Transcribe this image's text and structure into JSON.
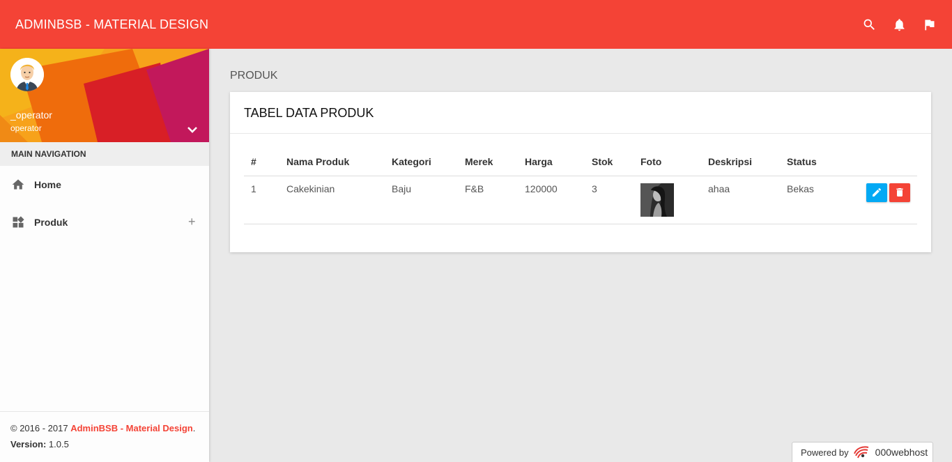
{
  "app": {
    "title": "ADMINBSB - MATERIAL DESIGN",
    "accent_color": "#f44336"
  },
  "topbar": {
    "icons": [
      "search-icon",
      "bell-icon",
      "flag-icon"
    ]
  },
  "user": {
    "name": "_operator",
    "role": "operator"
  },
  "sidebar": {
    "header": "MAIN NAVIGATION",
    "items": [
      {
        "label": "Home",
        "icon": "home-icon"
      },
      {
        "label": "Produk",
        "icon": "widgets-icon",
        "expand": "+"
      }
    ]
  },
  "footer": {
    "copyright": "© 2016 - 2017",
    "brand_link": "AdminBSB - Material Design",
    "brand_suffix": ".",
    "version_label": "Version:",
    "version_value": "1.0.5"
  },
  "page": {
    "title": "PRODUK"
  },
  "card": {
    "title": "TABEL DATA PRODUK",
    "columns": [
      "#",
      "Nama Produk",
      "Kategori",
      "Merek",
      "Harga",
      "Stok",
      "Foto",
      "Deskripsi",
      "Status",
      ""
    ],
    "rows": [
      {
        "no": "1",
        "nama": "Cakekinian",
        "kategori": "Baju",
        "merek": "F&B",
        "harga": "120000",
        "stok": "3",
        "foto": "product-photo",
        "deskripsi": "ahaa",
        "status": "Bekas"
      }
    ],
    "edit_color": "#03a9f4",
    "delete_color": "#f44336"
  },
  "powered": {
    "label": "Powered by",
    "host": "000webhost"
  }
}
